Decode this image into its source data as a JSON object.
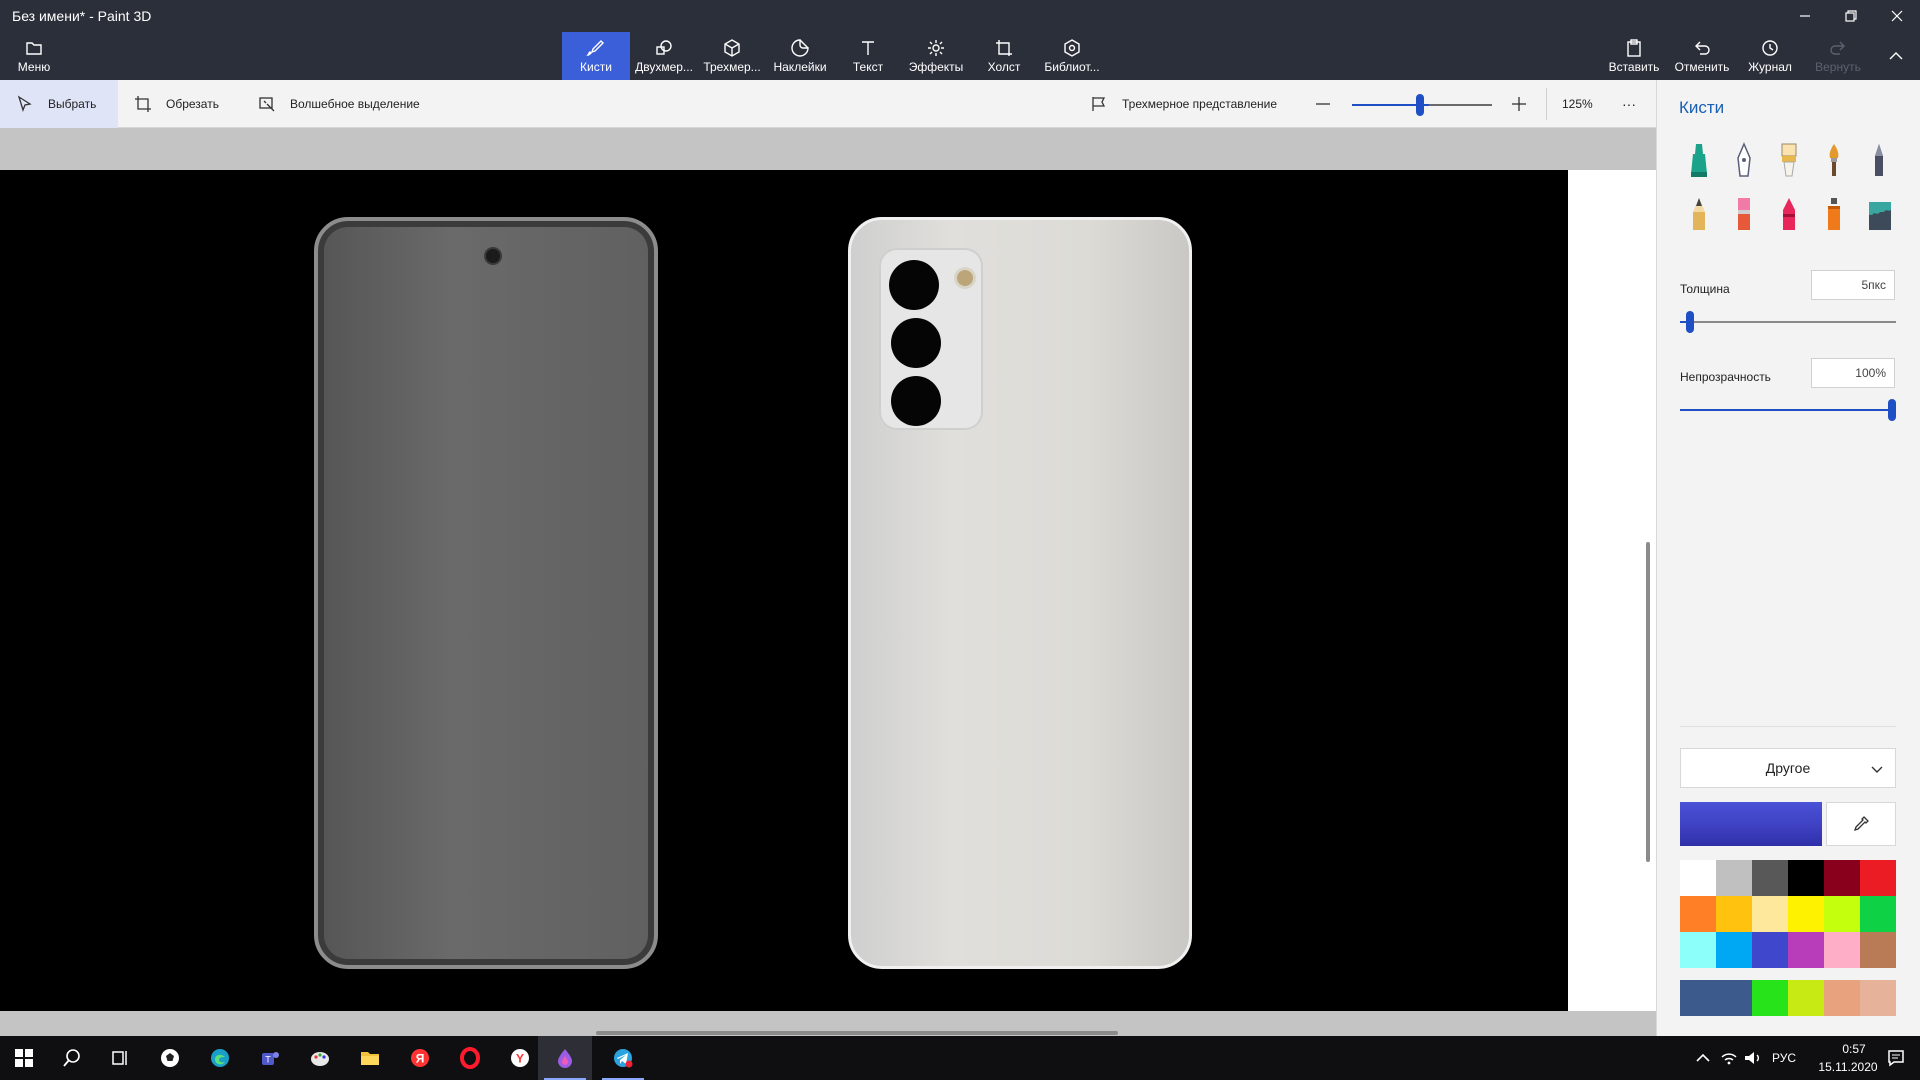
{
  "window": {
    "title": "Без имени* - Paint 3D"
  },
  "ribbon": {
    "menu": "Меню",
    "tools": [
      {
        "label": "Кисти",
        "icon": "brush-icon",
        "active": true
      },
      {
        "label": "Двухмер...",
        "icon": "2d-shapes-icon"
      },
      {
        "label": "Трехмер...",
        "icon": "3d-shapes-icon"
      },
      {
        "label": "Наклейки",
        "icon": "stickers-icon"
      },
      {
        "label": "Текст",
        "icon": "text-icon"
      },
      {
        "label": "Эффекты",
        "icon": "effects-icon"
      },
      {
        "label": "Холст",
        "icon": "canvas-icon"
      },
      {
        "label": "Библиот...",
        "icon": "library-icon"
      }
    ],
    "paste": "Вставить",
    "undo": "Отменить",
    "history": "Журнал",
    "redo": "Вернуть"
  },
  "commandbar": {
    "select": "Выбрать",
    "crop": "Обрезать",
    "magic_select": "Волшебное выделение",
    "view_3d": "Трехмерное представление",
    "zoom_level": "125%",
    "zoom_fraction": 0.55,
    "more": "···"
  },
  "panel": {
    "title": "Кисти",
    "brushes": [
      {
        "name": "marker",
        "color": "#1aa38a"
      },
      {
        "name": "calligraphy-pen",
        "color": "#6a6a8a"
      },
      {
        "name": "oil-brush",
        "color": "#e8b84a"
      },
      {
        "name": "watercolor",
        "color": "#e39a2a"
      },
      {
        "name": "pixel-pen",
        "color": "#4a4e62"
      },
      {
        "name": "pencil",
        "color": "#e3b45a"
      },
      {
        "name": "eraser",
        "color": "#f27aa6"
      },
      {
        "name": "crayon",
        "color": "#e8285a"
      },
      {
        "name": "spray-can",
        "color": "#f07a1a"
      },
      {
        "name": "fill",
        "color": "#3aa6a0"
      }
    ],
    "thickness_label": "Толщина",
    "thickness_value": "5пкс",
    "thickness_fraction": 0.03,
    "opacity_label": "Непрозрачность",
    "opacity_value": "100%",
    "opacity_fraction": 1.0,
    "color_mode": "Другое",
    "current_color": "#3d3fc0",
    "palette": [
      "#ffffff",
      "#c0c0c0",
      "#585858",
      "#000000",
      "#88001b",
      "#ec1c24",
      "#ff7f27",
      "#ffc20e",
      "#fde89c",
      "#fff200",
      "#c4ff0e",
      "#0ed145",
      "#8cfffb",
      "#00a8f3",
      "#3f48cc",
      "#b83dba",
      "#ffaec8",
      "#b97a56"
    ],
    "custom_colors": [
      "#3c5a8c",
      "#27e41a",
      "#c8ea14",
      "#e8a27e",
      "#e6b39a"
    ]
  },
  "taskbar": {
    "apps": [
      {
        "name": "start-icon"
      },
      {
        "name": "search-icon"
      },
      {
        "name": "task-view-icon"
      },
      {
        "name": "soccer-ball-icon"
      },
      {
        "name": "edge-icon"
      },
      {
        "name": "teams-icon"
      },
      {
        "name": "paint-palette-icon"
      },
      {
        "name": "file-explorer-icon"
      },
      {
        "name": "yandex-icon"
      },
      {
        "name": "opera-icon"
      },
      {
        "name": "yandex-browser-icon"
      },
      {
        "name": "paint3d-icon"
      },
      {
        "name": "telegram-icon"
      }
    ],
    "language": "РУС",
    "time": "0:57",
    "date": "15.11.2020"
  }
}
